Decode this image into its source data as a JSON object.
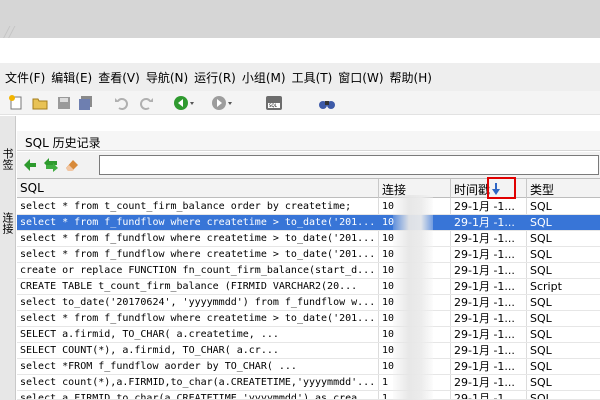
{
  "menu": [
    "文件(F)",
    "编辑(E)",
    "查看(V)",
    "导航(N)",
    "运行(R)",
    "小组(M)",
    "工具(T)",
    "窗口(W)",
    "帮助(H)"
  ],
  "side_tabs": [
    "书签",
    "连接"
  ],
  "panel": {
    "title": "SQL 历史记录",
    "search_value": ""
  },
  "columns": {
    "sql": "SQL",
    "conn": "连接",
    "time": "时间戳",
    "type": "类型"
  },
  "rows": [
    {
      "sql": "select * from t_count_firm_balance order by createtime;",
      "conn": "10",
      "time": "29-1月 -1...",
      "type": "SQL"
    },
    {
      "sql": "select * from f_fundflow where createtime > to_date('201...",
      "conn": "10",
      "time": "29-1月 -1...",
      "type": "SQL"
    },
    {
      "sql": "select * from f_fundflow where createtime > to_date('201...",
      "conn": "10",
      "time": "29-1月 -1...",
      "type": "SQL"
    },
    {
      "sql": "select * from f_fundflow where createtime > to_date('201...",
      "conn": "10",
      "time": "29-1月 -1...",
      "type": "SQL"
    },
    {
      "sql": "create or replace FUNCTION fn_count_firm_balance(start_d...",
      "conn": "10",
      "time": "29-1月 -1...",
      "type": "SQL"
    },
    {
      "sql": "CREATE TABLE t_count_firm_balance    (FIRMID VARCHAR2(20...",
      "conn": "10",
      "time": "29-1月 -1...",
      "type": "Script"
    },
    {
      "sql": "select to_date('20170624', 'yyyymmdd') from f_fundflow w...",
      "conn": "10",
      "time": "29-1月 -1...",
      "type": "SQL"
    },
    {
      "sql": "select * from f_fundflow where createtime > to_date('201...",
      "conn": "10",
      "time": "29-1月 -1...",
      "type": "SQL"
    },
    {
      "sql": "SELECT    a.firmid,     TO_CHAR(         a.createtime,    ...",
      "conn": "10",
      "time": "29-1月 -1...",
      "type": "SQL"
    },
    {
      "sql": "SELECT    COUNT(*),    a.firmid,    TO_CHAR(        a.cr...",
      "conn": "10",
      "time": "29-1月 -1...",
      "type": "SQL"
    },
    {
      "sql": "select *FROM    f_fundflow aorder by    TO_CHAR(         ...",
      "conn": "10",
      "time": "29-1月 -1...",
      "type": "SQL"
    },
    {
      "sql": "select count(*),a.FIRMID,to_char(a.CREATETIME,'yyyymmdd'...",
      "conn": "1",
      "time": "29-1月 -1...",
      "type": "SQL"
    },
    {
      "sql": "select a.FIRMID,to_char(a.CREATETIME,'yyyymmdd') as crea...",
      "conn": "1",
      "time": "29-1月 -1...",
      "type": "SQL"
    }
  ]
}
